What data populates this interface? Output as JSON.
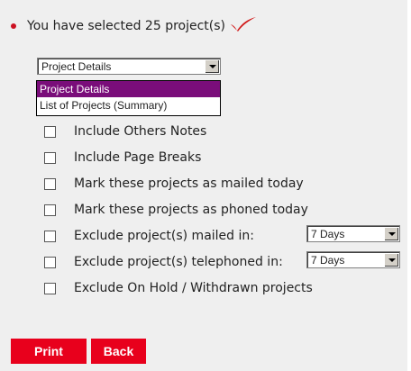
{
  "header": {
    "text": "You have selected 25 project(s)",
    "bullet_color": "#cc1122",
    "tick_icon": "checkmark-icon",
    "tick_color": "#d11a1a"
  },
  "report_select": {
    "value": "Project Details",
    "options": [
      "Project Details",
      "List of Projects (Summary)"
    ],
    "highlight_color": "#7a0d7a"
  },
  "options": [
    {
      "label": "Include Others Notes"
    },
    {
      "label": "Include Page Breaks"
    },
    {
      "label": "Mark these projects as mailed today"
    },
    {
      "label": "Mark these projects as phoned today"
    },
    {
      "label": "Exclude project(s) mailed in:",
      "select_value": "7 Days"
    },
    {
      "label": "Exclude project(s) telephoned in:",
      "select_value": "7 Days"
    },
    {
      "label": "Exclude On Hold / Withdrawn projects"
    }
  ],
  "buttons": {
    "print": "Print",
    "back": "Back",
    "color": "#e8001c"
  }
}
